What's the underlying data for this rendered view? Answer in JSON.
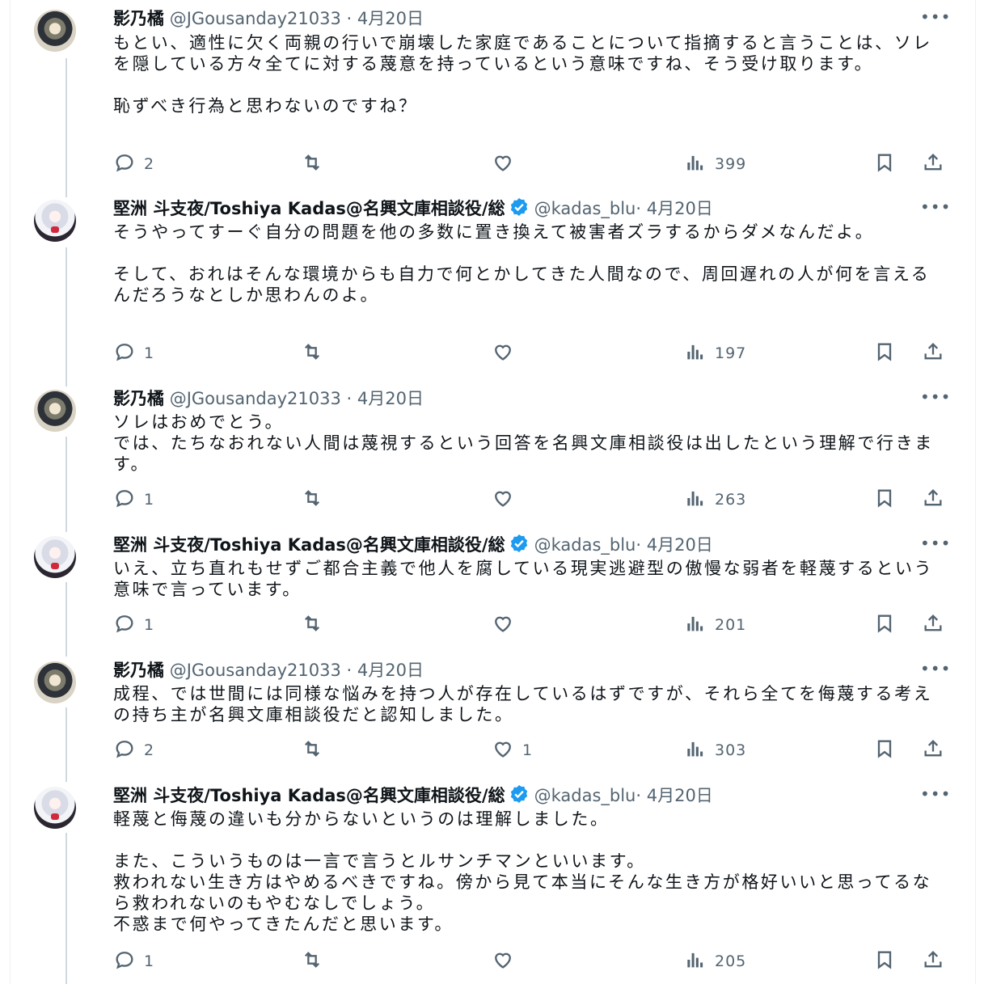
{
  "tweets": [
    {
      "avatar": "avatar-kageno",
      "name": "影乃橘",
      "handle": "@JGousanday21033",
      "sep": " · ",
      "date": "4月20日",
      "verified": false,
      "text": "もとい、適性に欠く両親の行いで崩壊した家庭であることについて指摘すると言うことは、ソレを隠している方々全てに対する蔑意を持っているという意味ですね、そう受け取ります。\n\n恥ずべき行為と思わないのですね？",
      "replies": "2",
      "retweets": "",
      "likes": "",
      "views": "399"
    },
    {
      "avatar": "avatar-kadas",
      "name": "堅洲 斗支夜/Toshiya Kadas@名興文庫相談役/総",
      "handle": "@kadas_blu",
      "sep": "· ",
      "date": "4月20日",
      "verified": true,
      "text": "そうやってすーぐ自分の問題を他の多数に置き換えて被害者ズラするからダメなんだよ。\n\nそして、おれはそんな環境からも自力で何とかしてきた人間なので、周回遅れの人が何を言えるんだろうなとしか思わんのよ。",
      "replies": "1",
      "retweets": "",
      "likes": "",
      "views": "197"
    },
    {
      "avatar": "avatar-kageno",
      "name": "影乃橘",
      "handle": "@JGousanday21033",
      "sep": " · ",
      "date": "4月20日",
      "verified": false,
      "text": "ソレはおめでとう。\nでは、たちなおれない人間は蔑視するという回答を名興文庫相談役は出したという理解で行きます。",
      "replies": "1",
      "retweets": "",
      "likes": "",
      "views": "263"
    },
    {
      "avatar": "avatar-kadas",
      "name": "堅洲 斗支夜/Toshiya Kadas@名興文庫相談役/総",
      "handle": "@kadas_blu",
      "sep": "· ",
      "date": "4月20日",
      "verified": true,
      "text": "いえ、立ち直れもせずご都合主義で他人を腐している現実逃避型の傲慢な弱者を軽蔑するという意味で言っています。",
      "replies": "1",
      "retweets": "",
      "likes": "",
      "views": "201"
    },
    {
      "avatar": "avatar-kageno",
      "name": "影乃橘",
      "handle": "@JGousanday21033",
      "sep": " · ",
      "date": "4月20日",
      "verified": false,
      "text": "成程、では世間には同様な悩みを持つ人が存在しているはずですが、それら全てを侮蔑する考えの持ち主が名興文庫相談役だと認知しました。",
      "replies": "2",
      "retweets": "",
      "likes": "1",
      "views": "303"
    },
    {
      "avatar": "avatar-kadas",
      "name": "堅洲 斗支夜/Toshiya Kadas@名興文庫相談役/総",
      "handle": "@kadas_blu",
      "sep": "· ",
      "date": "4月20日",
      "verified": true,
      "text": "軽蔑と侮蔑の違いも分からないというのは理解しました。\n\nまた、こういうものは一言で言うとルサンチマンといいます。\n救われない生き方はやめるべきですね。傍から見て本当にそんな生き方が格好いいと思ってるなら救われないのもやむなしでしょう。\n不惑まで何やってきたんだと思います。",
      "replies": "1",
      "retweets": "",
      "likes": "",
      "views": "205"
    }
  ],
  "icons": {
    "more": "more-horizontal-icon",
    "reply": "reply-icon",
    "retweet": "retweet-icon",
    "like": "like-icon",
    "views": "views-icon",
    "bookmark": "bookmark-icon",
    "share": "share-icon",
    "verified": "verified-badge-icon"
  },
  "colors": {
    "verified": "#1d9bf0",
    "muted": "#536471",
    "text": "#0f1419",
    "thread": "#cfd9de"
  }
}
